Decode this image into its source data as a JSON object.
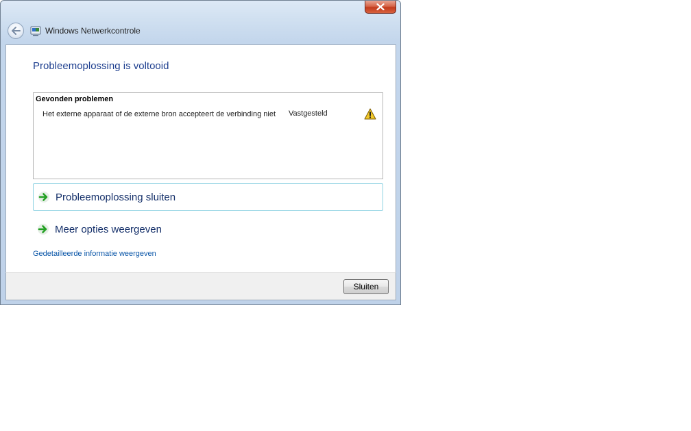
{
  "window": {
    "title": "Windows Netwerkcontrole",
    "icons": {
      "back": "back-arrow-icon",
      "app": "network-diagnostics-icon",
      "close": "close-x-icon"
    }
  },
  "main": {
    "heading": "Probleemoplossing is voltooid",
    "problems": {
      "title": "Gevonden problemen",
      "items": [
        {
          "description": "Het externe apparaat of de externe bron accepteert de verbinding niet",
          "status": "Vastgesteld",
          "icon": "warning-icon"
        }
      ]
    },
    "commands": [
      {
        "label": "Probleemoplossing sluiten",
        "icon": "green-arrow-icon",
        "selected": true
      },
      {
        "label": "Meer opties weergeven",
        "icon": "green-arrow-icon",
        "selected": false
      }
    ],
    "detail_link": "Gedetailleerde informatie weergeven"
  },
  "footer": {
    "close_button": "Sluiten"
  },
  "colors": {
    "heading": "#1e3f8f",
    "link": "#0a56a8",
    "accent_border": "#8ed2e2",
    "close_red": "#c23a1c"
  }
}
